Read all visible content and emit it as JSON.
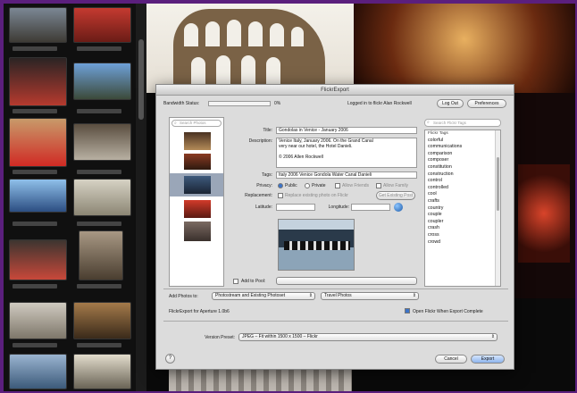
{
  "dialog": {
    "title": "FlickrExport",
    "bandwidth_label": "Bandwidth Status:",
    "bandwidth_value": "0%",
    "logged_in_text": "Logged in to flickr Alan Rockwell",
    "logout_label": "Log Out",
    "preferences_label": "Preferences",
    "search_photos_placeholder": "Search Photos",
    "title_label": "Title:",
    "title_value": "Gondolas in Venice - January 2006",
    "description_label": "Description:",
    "description_lines": [
      "Venice Italy, January 2006. On the Grand Canal",
      "very near our hotel, the Hotel Danieli.",
      "",
      "© 2006 Allen Rockwell"
    ],
    "tags_label": "Tags:",
    "tags_value": "Italy 2006 Venice Gondola Water Canal Danieli",
    "privacy_label": "Privacy:",
    "privacy_public": "Public",
    "privacy_private": "Private",
    "privacy_friends": "Allow Friends",
    "privacy_family": "Allow Family",
    "replacement_label": "Replacement:",
    "replacement_option": "Replace existing photo on Flickr",
    "get_existing_label": "Get Existing Post",
    "latitude_label": "Latitude:",
    "longitude_label": "Longitude:",
    "add_to_pool_label": "Add to Pool:",
    "add_photos_to_label": "Add Photos to:",
    "add_photos_to_value": "Photostream and Existing Photoset",
    "photoset_value": "Travel Photos",
    "version_text": "FlickrExport for Aperture 1.0b6",
    "open_after_export": "Open Flickr When Export Complete",
    "version_preset_label": "Version Preset:",
    "version_preset_value": "JPEG – Fit within 1500 x 1500 – Flickr",
    "cancel_label": "Cancel",
    "export_label": "Export",
    "help_label": "?",
    "search_tags_placeholder": "Search Flickr Tags",
    "tags_list": [
      "Flickr Tags",
      "colorful",
      "communications",
      "comparison",
      "composer",
      "constitution",
      "construction",
      "control",
      "controlled",
      "cool",
      "crafts",
      "country",
      "couple",
      "coupler",
      "crash",
      "cross",
      "crowd"
    ]
  },
  "accent_colors": {
    "frame": "#5b1f7d",
    "selection": "#3b73c8"
  }
}
